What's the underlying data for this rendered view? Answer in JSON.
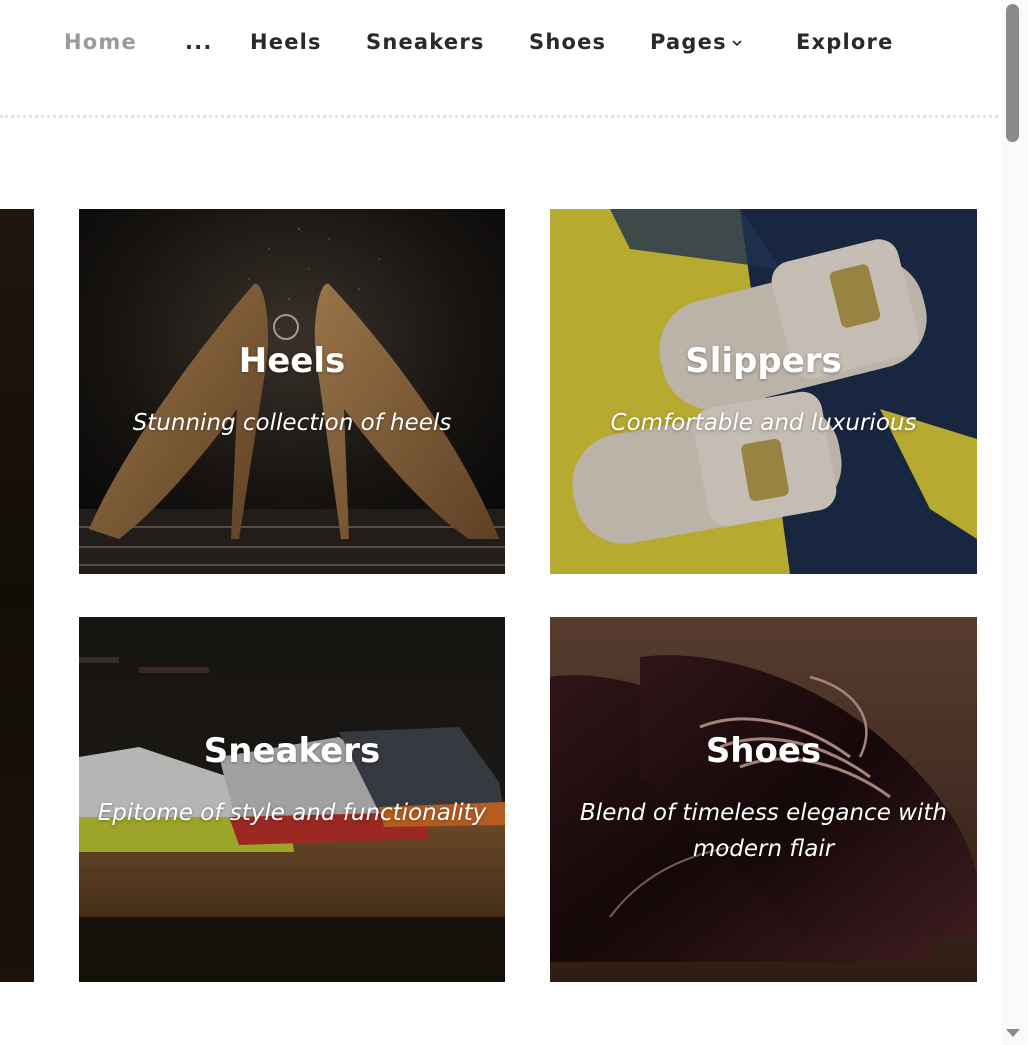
{
  "nav": {
    "items": [
      {
        "label": "Home",
        "active": true
      },
      {
        "label": "...",
        "active": false
      },
      {
        "label": "Heels",
        "active": false
      },
      {
        "label": "Sneakers",
        "active": false
      },
      {
        "label": "Shoes",
        "active": false
      },
      {
        "label": "Pages",
        "active": false
      },
      {
        "label": "Explore",
        "active": false
      }
    ]
  },
  "cards": [
    {
      "title": "Heels",
      "subtitle": "Stunning collection of heels"
    },
    {
      "title": "Slippers",
      "subtitle": "Comfortable and luxurious"
    },
    {
      "title": "Sneakers",
      "subtitle": "Epitome of style and functionality"
    },
    {
      "title": "Shoes",
      "subtitle": "Blend of timeless elegance with modern flair"
    }
  ],
  "colors": {
    "nav_text": "#2a2a2a",
    "nav_active": "#9a9a9a",
    "divider": "#e3e3e3",
    "slipper_yellow": "#e0d23a",
    "denim": "#1d2c4a"
  }
}
